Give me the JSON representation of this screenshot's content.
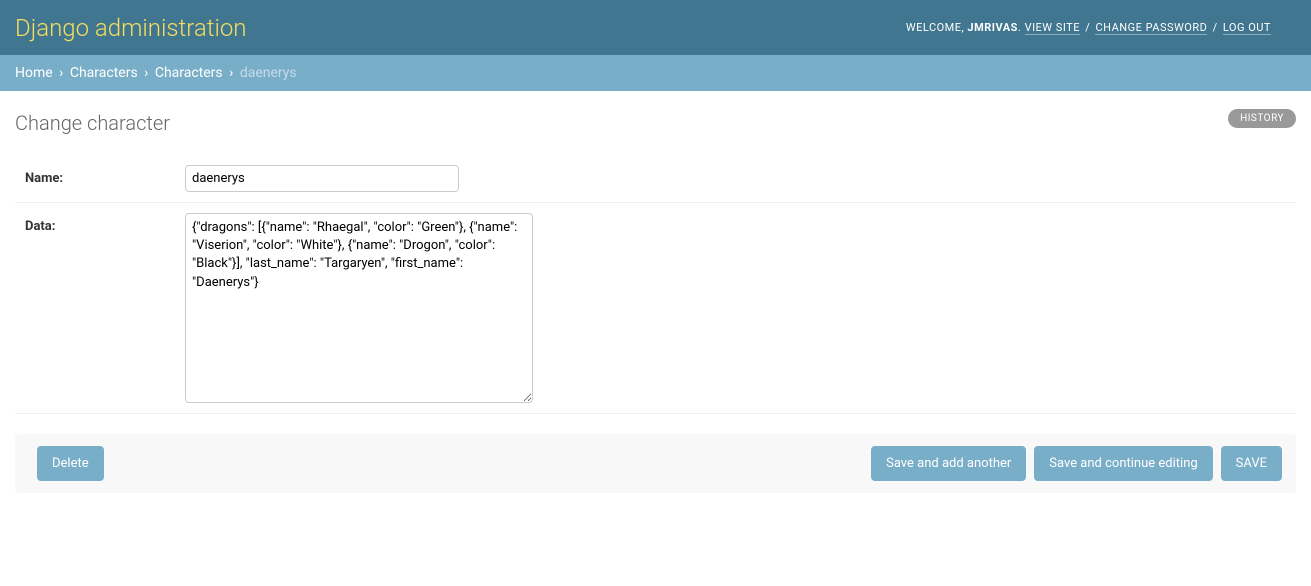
{
  "header": {
    "site_title": "Django administration",
    "welcome_prefix": "Welcome, ",
    "username": "jmrivas",
    "period": ". ",
    "view_site": "View site",
    "change_password": "Change password",
    "log_out": "Log out",
    "separator": " / "
  },
  "breadcrumbs": {
    "home": "Home",
    "app": "Characters",
    "model": "Characters",
    "object": "daenerys",
    "separator": " › "
  },
  "page": {
    "title": "Change character",
    "history_label": "History"
  },
  "form": {
    "name": {
      "label": "Name:",
      "value": "daenerys"
    },
    "data": {
      "label": "Data:",
      "value": "{\"dragons\": [{\"name\": \"Rhaegal\", \"color\": \"Green\"}, {\"name\": \"Viserion\", \"color\": \"White\"}, {\"name\": \"Drogon\", \"color\": \"Black\"}], \"last_name\": \"Targaryen\", \"first_name\": \"Daenerys\"}"
    }
  },
  "actions": {
    "delete": "Delete",
    "save_add_another": "Save and add another",
    "save_continue": "Save and continue editing",
    "save": "Save"
  }
}
